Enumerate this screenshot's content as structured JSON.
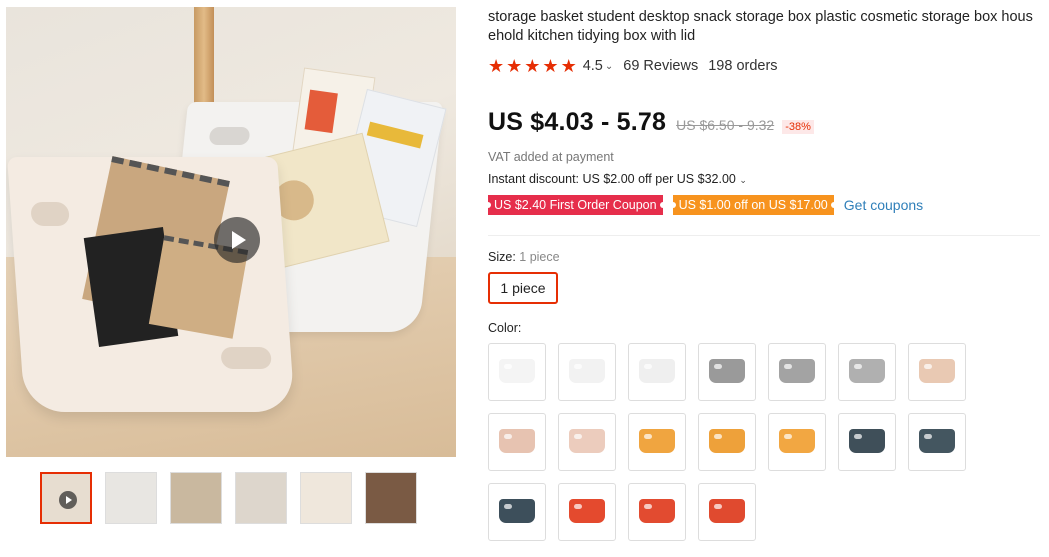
{
  "product": {
    "title": "storage basket student desktop snack storage box plastic cosmetic storage box household kitchen tidying box with lid",
    "rating": "4.5",
    "reviews": "69 Reviews",
    "orders": "198 orders",
    "star_color": "#e62e04"
  },
  "price": {
    "current": "US $4.03 - 5.78",
    "original": "US $6.50 - 9.32",
    "discount": "-38%",
    "vat_note": "VAT added at payment",
    "instant_discount": "Instant discount: US $2.00 off per US $32.00"
  },
  "coupons": [
    {
      "label": "US $2.40 First Order Coupon",
      "color": "#e62e4b"
    },
    {
      "label": "US $1.00 off on US $17.00",
      "color": "#f7931e"
    }
  ],
  "get_coupons_label": "Get coupons",
  "size": {
    "label": "Size:",
    "selected": "1 piece",
    "options": [
      "1 piece"
    ]
  },
  "color": {
    "label": "Color:",
    "swatches": [
      {
        "bin_color": "#f4f4f4"
      },
      {
        "bin_color": "#f2f2f2"
      },
      {
        "bin_color": "#efefef"
      },
      {
        "bin_color": "#9a9a9a"
      },
      {
        "bin_color": "#a3a3a3"
      },
      {
        "bin_color": "#b0b0b0"
      },
      {
        "bin_color": "#e9c9b3"
      },
      {
        "bin_color": "#e7c3b1"
      },
      {
        "bin_color": "#ecccbd"
      },
      {
        "bin_color": "#f0a540"
      },
      {
        "bin_color": "#eea13a"
      },
      {
        "bin_color": "#f2a742"
      },
      {
        "bin_color": "#3f4f59"
      },
      {
        "bin_color": "#445660"
      },
      {
        "bin_color": "#3d4f5b"
      },
      {
        "bin_color": "#e44a2e"
      },
      {
        "bin_color": "#e24b30"
      },
      {
        "bin_color": "#e04a2f"
      }
    ]
  },
  "gallery": {
    "thumbnails": [
      {
        "bg": "#e7ddd0",
        "has_play": true,
        "active": true
      },
      {
        "bg": "#e8e6e2",
        "has_play": false,
        "active": false
      },
      {
        "bg": "#c9b89f",
        "has_play": false,
        "active": false
      },
      {
        "bg": "#ddd6cc",
        "has_play": false,
        "active": false
      },
      {
        "bg": "#efe7dc",
        "has_play": false,
        "active": false
      },
      {
        "bg": "#7a5a44",
        "has_play": false,
        "active": false
      }
    ]
  }
}
